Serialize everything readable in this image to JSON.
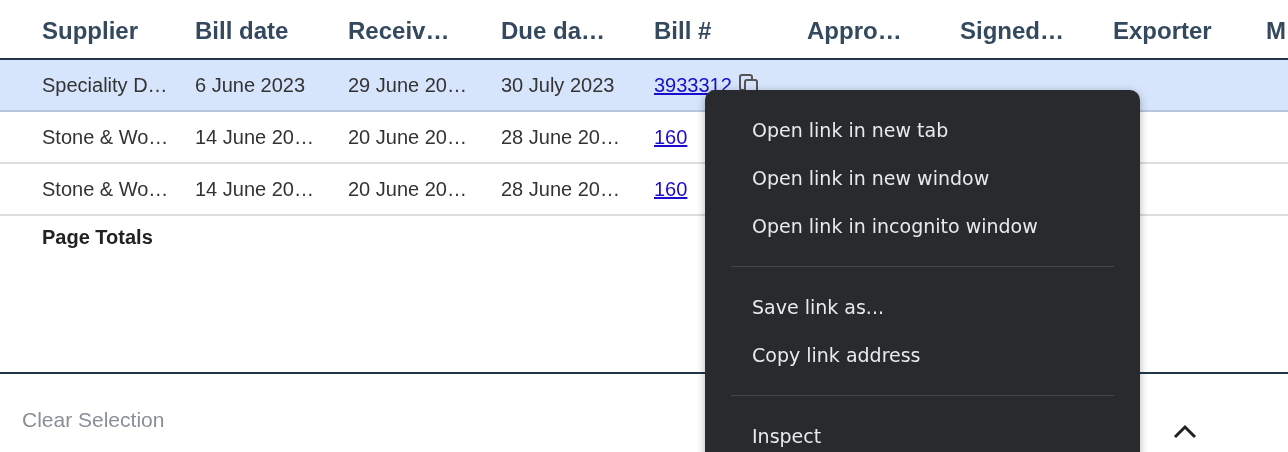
{
  "table": {
    "columns": [
      "Supplier",
      "Bill date",
      "Receiv…",
      "Due da…",
      "Bill #",
      "Appro…",
      "Signed…",
      "Exporter",
      "M"
    ],
    "rows": [
      {
        "selected": true,
        "supplier": "Speciality D…",
        "bill_date": "6 June 2023",
        "received": "29 June 20…",
        "due_date": "30 July 2023",
        "bill_number": "3933312",
        "copy_button": true
      },
      {
        "selected": false,
        "supplier": "Stone & Wo…",
        "bill_date": "14 June 20…",
        "received": "20 June 20…",
        "due_date": "28 June 20…",
        "bill_number": "160",
        "copy_button": false
      },
      {
        "selected": false,
        "supplier": "Stone & Wo…",
        "bill_date": "14 June 20…",
        "received": "20 June 20…",
        "due_date": "28 June 20…",
        "bill_number": "160",
        "copy_button": false
      }
    ],
    "totals_label": "Page Totals"
  },
  "footer": {
    "clear_selection": "Clear Selection"
  },
  "context_menu": {
    "groups": [
      [
        "Open link in new tab",
        "Open link in new window",
        "Open link in incognito window"
      ],
      [
        "Save link as...",
        "Copy link address"
      ],
      [
        "Inspect"
      ]
    ]
  }
}
